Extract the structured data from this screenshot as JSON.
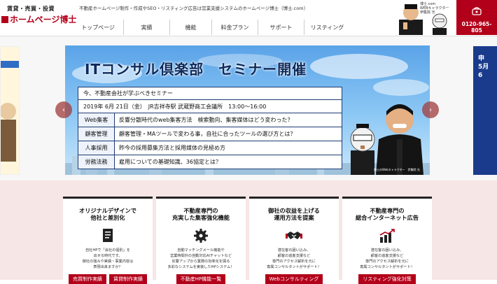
{
  "logo": {
    "sub": "賃貸・売買・投資",
    "main": "ホームページ博士"
  },
  "header": {
    "tagline": "不動産ホームページ制作・作成やSEO・リスティング広告は営業支援システムのホームページ博士（博士.com）",
    "character_caption": [
      "博士.com",
      "WEBキャラクター",
      "伊集院 光"
    ],
    "phone": "0120-965-805"
  },
  "nav": [
    {
      "label": "トップページ"
    },
    {
      "label": "実績"
    },
    {
      "label": "機能"
    },
    {
      "label": "料金プラン"
    },
    {
      "label": "サポート"
    },
    {
      "label": "リスティング"
    }
  ],
  "banner": {
    "title": "ITコンサル倶楽部　セミナー開催",
    "intro": "今、不動産会社が学ぶべきセミナー",
    "date_place": "2019年 6月 21日（金）　JR吉祥寺駅 武蔵野商工会議所　13:00～16:00",
    "rows": [
      {
        "label": "Web集客",
        "text": "反響分散時代のweb集客方法　検索動向、集客媒体はどう変わった？"
      },
      {
        "label": "顧客管理",
        "text": "顧客管理・MAツールで変わる事，自社に合ったツールの選び方とは？"
      },
      {
        "label": "人事採用",
        "text": "昨今の採用募集方法と採用媒体の見極め方"
      },
      {
        "label": "労務法務",
        "text": "雇用についての基礎知識、36協定とは？"
      }
    ],
    "credit": "博士のWebキャラクター　伊集院 光"
  },
  "side_slide_right": {
    "text": [
      "申",
      "5月",
      "6"
    ]
  },
  "carousel": {
    "prev": "‹",
    "next": "›"
  },
  "cards": [
    {
      "title": [
        "オリジナルデザインで",
        "他社と差別化"
      ],
      "icon": "document-icon",
      "desc": [
        "自社HPで「会社の個別」を",
        "出せる時代です。",
        "御社の強みや実績・事業内容は",
        "表現出来ますか？"
      ],
      "buttons": [
        "売買制作実績",
        "賃貸制作実績"
      ]
    },
    {
      "title": [
        "不動産専門の",
        "充実した集客強化機能"
      ],
      "icon": "gear-icon",
      "desc": [
        "自動マッチングメール機能や",
        "営業時間外の自動対応AIチャットなど",
        "反響アップから業務の効率化を図る",
        "多彩なシステムを実装したHPシステム！"
      ],
      "buttons": [
        "不動産HP機能一覧"
      ]
    },
    {
      "title": [
        "御社の収益を上げる",
        "運用方法を提案"
      ],
      "icon": "handshake-icon",
      "desc": [
        "潜在客の囲い込み、",
        "顧客の追客支援など",
        "専門のアクセス解析を元に",
        "専属コンサルタントがサポート！"
      ],
      "buttons": [
        "Webコンサルティング"
      ]
    },
    {
      "title": [
        "不動産専門の",
        "総合インターネット広告"
      ],
      "icon": "chart-icon",
      "desc": [
        "潜在客の囲い込み、",
        "顧客の追客支援など",
        "専門のアクセス解析を元に",
        "専属コンサルタントがサポート！"
      ],
      "buttons": [
        "リスティング強化対策"
      ]
    }
  ],
  "colors": {
    "brand": "#b3001a",
    "navy": "#1d3b72",
    "feature_bg": "#f7e6e6"
  }
}
